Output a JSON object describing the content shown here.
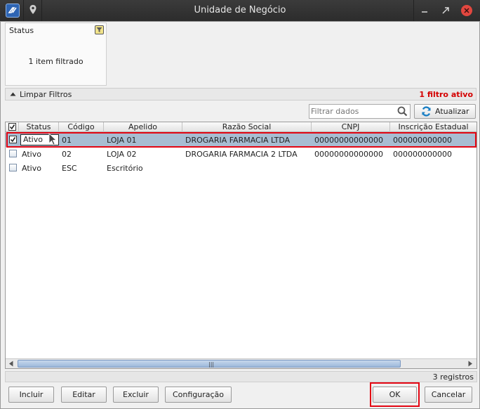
{
  "window": {
    "title": "Unidade de Negócio"
  },
  "filter_card": {
    "title": "Status",
    "summary": "1 item filtrado"
  },
  "filter_bar": {
    "clear_label": "Limpar Filtros",
    "active_count": "1 filtro ativo"
  },
  "search": {
    "placeholder": "Filtrar dados"
  },
  "refresh_label": "Atualizar",
  "table": {
    "columns": [
      "Status",
      "Código",
      "Apelido",
      "Razão Social",
      "CNPJ",
      "Inscrição Estadual"
    ],
    "rows": [
      {
        "checked": true,
        "status": "Ativo",
        "codigo": "01",
        "apelido": "LOJA 01",
        "razao": "DROGARIA FARMACIA LTDA",
        "cnpj": "00000000000000",
        "ie": "000000000000"
      },
      {
        "checked": false,
        "status": "Ativo",
        "codigo": "02",
        "apelido": "LOJA 02",
        "razao": "DROGARIA FARMACIA 2 LTDA",
        "cnpj": "00000000000000",
        "ie": "000000000000"
      },
      {
        "checked": false,
        "status": "Ativo",
        "codigo": "ESC",
        "apelido": "Escritório",
        "razao": "",
        "cnpj": "",
        "ie": ""
      }
    ]
  },
  "records": "3 registros",
  "buttons": {
    "incluir": "Incluir",
    "editar": "Editar",
    "excluir": "Excluir",
    "configuracao": "Configuração",
    "ok": "OK",
    "cancelar": "Cancelar"
  },
  "colors": {
    "highlight": "#e30613",
    "selected_row": "#a8bdd2",
    "active_filter": "#d40000"
  }
}
